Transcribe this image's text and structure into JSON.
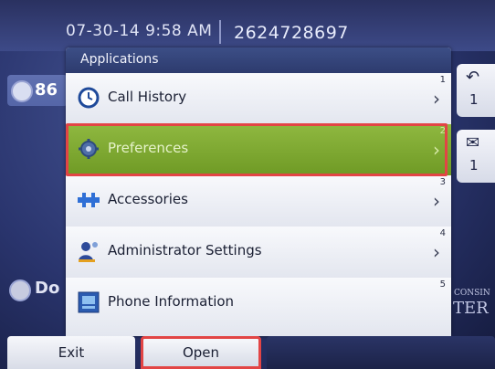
{
  "status_bar": {
    "datetime": "07-30-14 9:58 AM",
    "phone_number": "2624728697"
  },
  "background": {
    "line_label": "86",
    "dir_label": "Do",
    "right_keys": [
      {
        "icon": "call-return-icon",
        "count": "1"
      },
      {
        "icon": "voicemail-icon",
        "count": "1"
      }
    ],
    "watermark_top": "CONSIN",
    "watermark_bottom": "TER"
  },
  "applications": {
    "title": "Applications",
    "items": [
      {
        "label": "Call History",
        "icon": "clock-icon",
        "number": "1",
        "selected": false
      },
      {
        "label": "Preferences",
        "icon": "gear-icon",
        "number": "2",
        "selected": true
      },
      {
        "label": "Accessories",
        "icon": "puzzle-icon",
        "number": "3",
        "selected": false
      },
      {
        "label": "Administrator Settings",
        "icon": "admin-icon",
        "number": "4",
        "selected": false
      },
      {
        "label": "Phone Information",
        "icon": "info-icon",
        "number": "5",
        "selected": false
      }
    ]
  },
  "softkeys": {
    "exit": "Exit",
    "open": "Open"
  },
  "colors": {
    "selected_green": "#7ea832",
    "highlight_red": "#e24545",
    "header_blue": "#34467a"
  }
}
